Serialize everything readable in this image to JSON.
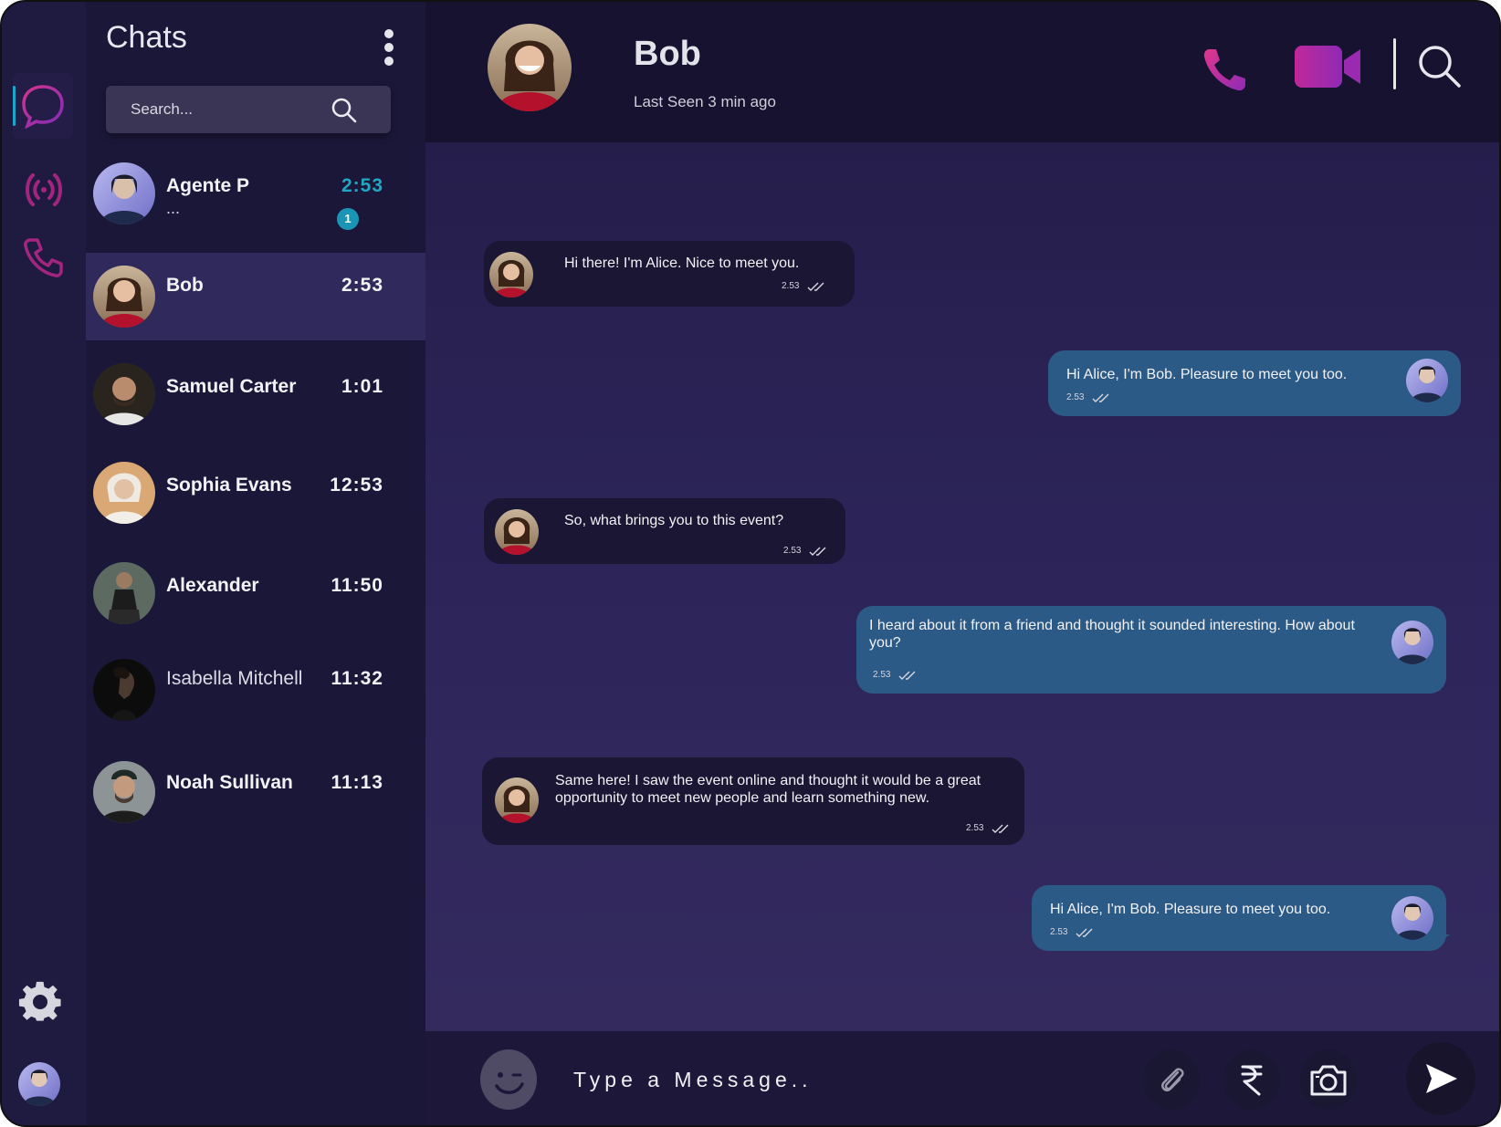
{
  "theme": {
    "accent_cyan": "#1aa7c9",
    "accent_magenta": "#c2185b",
    "incoming_bubble": "#1a1633",
    "outgoing_bubble": "#2c5a86",
    "panel_bg": "#1b1738"
  },
  "rail": {
    "items": [
      {
        "icon": "chat-bubble-icon",
        "active": true
      },
      {
        "icon": "broadcast-icon",
        "active": false
      },
      {
        "icon": "phone-icon",
        "active": false
      }
    ],
    "settings_icon": "gear-icon",
    "profile_avatar": "user-avatar"
  },
  "chat_list": {
    "title": "Chats",
    "menu_icon": "kebab-menu-icon",
    "search": {
      "placeholder": "Search..."
    },
    "contacts": [
      {
        "name": "Agente P",
        "time": "2:53",
        "preview": "...",
        "unread": "1"
      },
      {
        "name": "Bob",
        "time": "2:53",
        "active": true
      },
      {
        "name": "Samuel Carter",
        "time": "1:01"
      },
      {
        "name": "Sophia Evans",
        "time": "12:53"
      },
      {
        "name": "Alexander",
        "time": "11:50"
      },
      {
        "name": "Isabella Mitchell",
        "time": "11:32"
      },
      {
        "name": "Noah Sullivan",
        "time": "11:13"
      }
    ]
  },
  "header": {
    "name": "Bob",
    "status": "Last Seen 3 min ago",
    "icons": [
      "phone-icon",
      "video-camera-icon",
      "search-icon"
    ]
  },
  "messages": [
    {
      "direction": "in",
      "text": "Hi there! I'm Alice. Nice to meet you.",
      "time": "2.53"
    },
    {
      "direction": "out",
      "text": "Hi Alice, I'm Bob. Pleasure to meet you too.",
      "time": "2.53"
    },
    {
      "direction": "in",
      "text": "So, what brings you to this event?",
      "time": "2.53"
    },
    {
      "direction": "out",
      "text": "I heard about it from a friend and thought it sounded interesting. How about you?",
      "time": "2.53"
    },
    {
      "direction": "in",
      "text": "Same here! I saw the event online and thought it would be a great opportunity to meet new people and learn something new.",
      "time": "2.53"
    },
    {
      "direction": "out",
      "text": "Hi Alice, I'm Bob. Pleasure to meet you too.",
      "time": "2.53"
    }
  ],
  "composer": {
    "placeholder": "Type a Message..",
    "icons": [
      "emoji-icon",
      "attachment-icon",
      "rupee-icon",
      "camera-icon",
      "send-icon"
    ]
  }
}
